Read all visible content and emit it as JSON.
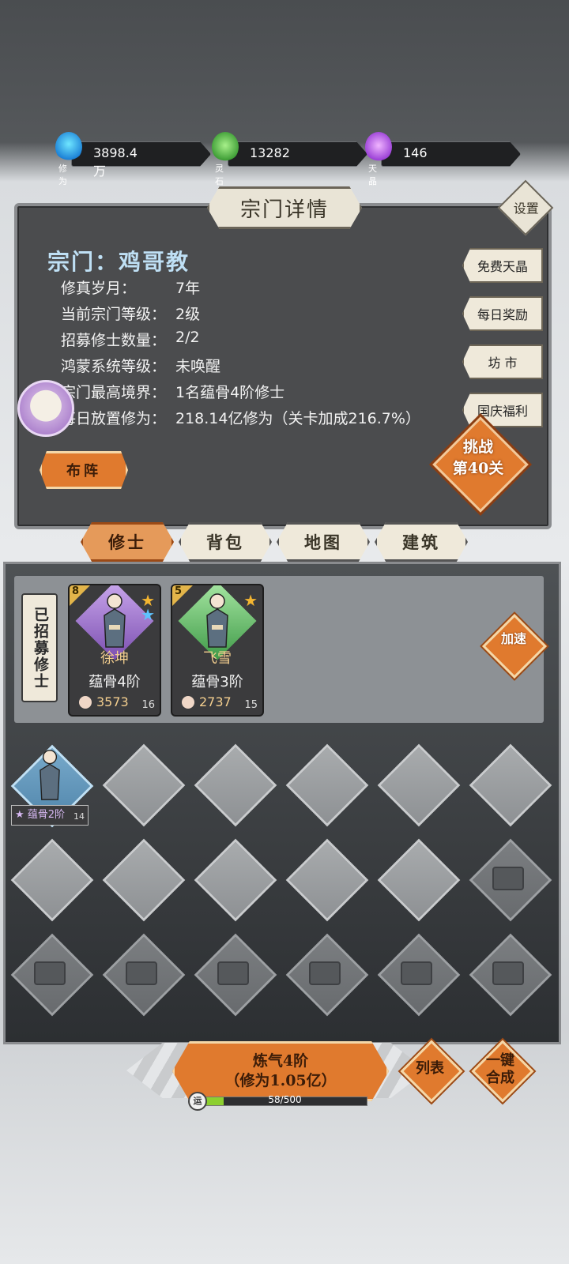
{
  "resources": {
    "cultivation": {
      "label": "修为",
      "value": "3898.4万"
    },
    "spirit_stone": {
      "label": "灵石",
      "value": "13282"
    },
    "crystal": {
      "label": "天晶",
      "value": "146"
    }
  },
  "panel": {
    "title": "宗门详情",
    "settings_label": "设置",
    "sect_name": "宗门：鸡哥教",
    "info": [
      {
        "label": "修真岁月：",
        "value": "7年"
      },
      {
        "label": "当前宗门等级：",
        "value": "2级"
      },
      {
        "label": "招募修士数量：",
        "value": "2/2"
      },
      {
        "label": "鸿蒙系统等级：",
        "value": "未唤醒"
      },
      {
        "label": "宗门最高境界：",
        "value": "1名蕴骨4阶修士"
      },
      {
        "label": "每日放置修为：",
        "value": "218.14亿修为（关卡加成216.7%）"
      }
    ],
    "side_buttons": [
      "免费天晶",
      "每日奖励",
      "坊 市",
      "国庆福利"
    ],
    "formation_label": "布阵",
    "challenge_line1": "挑战",
    "challenge_line2": "第40关"
  },
  "tabs": [
    "修士",
    "背包",
    "地图",
    "建筑"
  ],
  "active_tab": "修士",
  "recruited": {
    "label": "已招募修士",
    "speed_label": "加速",
    "cards": [
      {
        "level": "8",
        "name": "徐坤",
        "realm": "蕴骨4阶",
        "power": "3573",
        "count": "16"
      },
      {
        "level": "5",
        "name": "飞雪",
        "realm": "蕴骨3阶",
        "power": "2737",
        "count": "15"
      }
    ]
  },
  "slots": {
    "occupied": {
      "realm": "★ 蕴骨2阶",
      "count": "14"
    }
  },
  "bottom": {
    "merge_line1": "炼气4阶",
    "merge_line2": "（修为1.05亿）",
    "list_label": "列表",
    "auto_line1": "一键",
    "auto_line2": "合成",
    "luck_icon": "运",
    "luck_text": "58/500",
    "luck_progress": 0.116
  },
  "colors": {
    "accent": "#e07a2e",
    "panel": "#4b4c4e",
    "name_gold": "#f4cf8f",
    "sect_blue": "#bfe0f5"
  }
}
